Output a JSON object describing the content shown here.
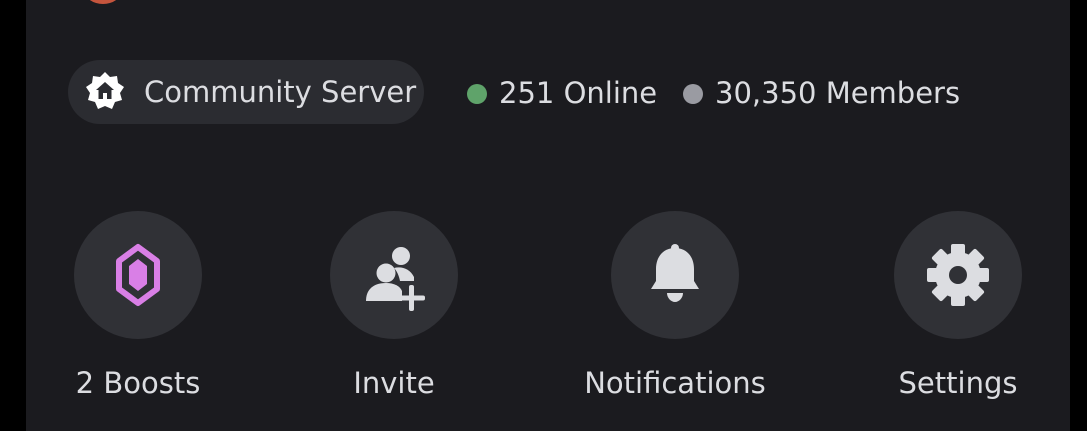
{
  "server": {
    "avatar_icon": "server-avatar",
    "avatar_color": "#c5553d"
  },
  "community": {
    "label": "Community Server",
    "icon": "community-home-icon"
  },
  "stats": {
    "online_text": "251 Online",
    "online_color": "#5fa36a",
    "members_text": "30,350 Members",
    "members_color": "#9a9ba2"
  },
  "actions": [
    {
      "label": "2 Boosts",
      "icon": "boost-gem-icon",
      "accent": "#d97fe6"
    },
    {
      "label": "Invite",
      "icon": "add-member-icon"
    },
    {
      "label": "Notifications",
      "icon": "bell-icon"
    },
    {
      "label": "Settings",
      "icon": "gear-icon"
    }
  ]
}
